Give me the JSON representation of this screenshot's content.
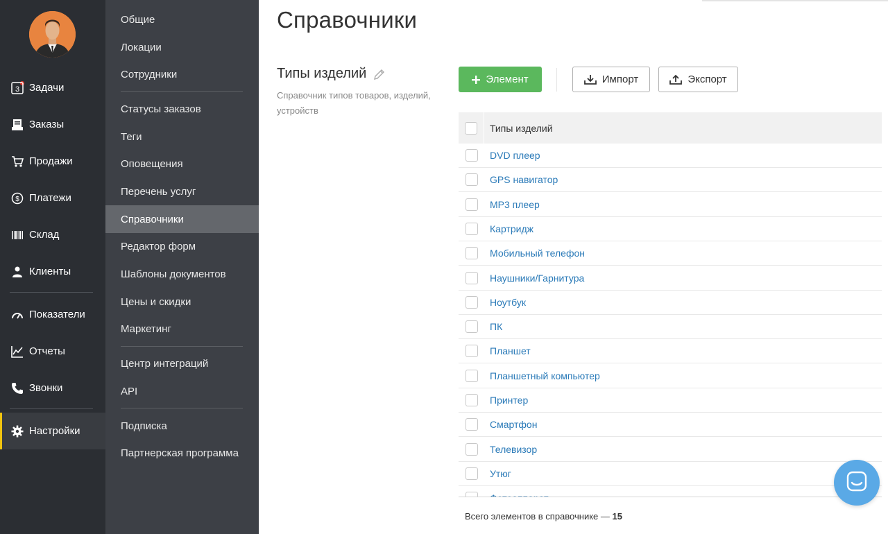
{
  "sidebar": {
    "items": [
      {
        "label": "Задачи",
        "icon": "tasks-icon",
        "badge_text": "3"
      },
      {
        "label": "Заказы",
        "icon": "orders-icon"
      },
      {
        "label": "Продажи",
        "icon": "cart-icon"
      },
      {
        "label": "Платежи",
        "icon": "dollar-icon"
      },
      {
        "label": "Склад",
        "icon": "barcode-icon"
      },
      {
        "label": "Клиенты",
        "icon": "user-icon"
      },
      {
        "label": "Показатели",
        "icon": "gauge-icon"
      },
      {
        "label": "Отчеты",
        "icon": "chart-icon"
      },
      {
        "label": "Звонки",
        "icon": "phone-icon"
      },
      {
        "label": "Настройки",
        "icon": "gear-icon",
        "active": true
      }
    ]
  },
  "subnav": {
    "items": [
      {
        "label": "Общие"
      },
      {
        "label": "Локации"
      },
      {
        "label": "Сотрудники"
      },
      {
        "label": "Статусы заказов"
      },
      {
        "label": "Теги"
      },
      {
        "label": "Оповещения"
      },
      {
        "label": "Перечень услуг"
      },
      {
        "label": "Справочники",
        "active": true
      },
      {
        "label": "Редактор форм"
      },
      {
        "label": "Шаблоны документов"
      },
      {
        "label": "Цены и скидки"
      },
      {
        "label": "Маркетинг"
      },
      {
        "label": "Центр интеграций"
      },
      {
        "label": "API"
      },
      {
        "label": "Подписка"
      },
      {
        "label": "Партнерская программа"
      }
    ]
  },
  "main": {
    "page_title": "Справочники",
    "directory_title": "Типы изделий",
    "directory_description": "Справочник типов товаров, изделий, устройств",
    "buttons": {
      "add_label": "Элемент",
      "import_label": "Импорт",
      "export_label": "Экспорт"
    },
    "table": {
      "header": "Типы изделий",
      "rows": [
        "DVD плеер",
        "GPS навигатор",
        "MP3 плеер",
        "Картридж",
        "Мобильный телефон",
        "Наушники/Гарнитура",
        "Ноутбук",
        "ПК",
        "Планшет",
        "Планшетный компьютер",
        "Принтер",
        "Смартфон",
        "Телевизор",
        "Утюг",
        "Фотоаппарат"
      ]
    },
    "total_label": "Всего элементов в справочнике —",
    "total_count": "15"
  },
  "colors": {
    "sidebar_bg": "#2b2e33",
    "subnav_bg": "#3d4046",
    "active_accent": "#f1c40f",
    "add_button": "#5bb85d",
    "link": "#2a7ab8",
    "chat_button": "#5aa9e6"
  }
}
